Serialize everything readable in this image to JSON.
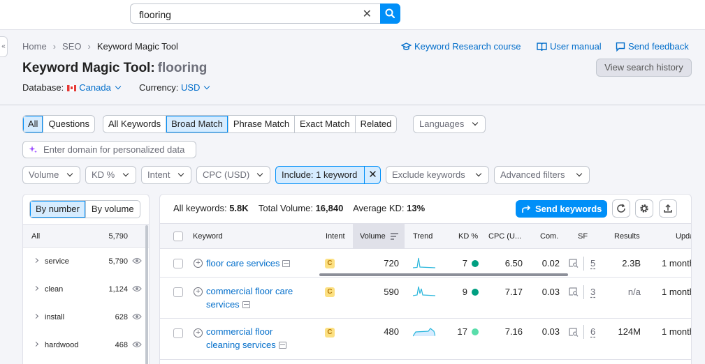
{
  "search": {
    "value": "flooring"
  },
  "breadcrumb": {
    "home": "Home",
    "seo": "SEO",
    "current": "Keyword Magic Tool"
  },
  "header_links": {
    "course": "Keyword Research course",
    "manual": "User manual",
    "feedback": "Send feedback"
  },
  "page": {
    "title": "Keyword Magic Tool:",
    "keyword": "flooring",
    "history_button": "View search history"
  },
  "database": {
    "label": "Database:",
    "value": "Canada",
    "currency_label": "Currency:",
    "currency_value": "USD"
  },
  "question_filter": [
    "All",
    "Questions"
  ],
  "match_filter": [
    "All Keywords",
    "Broad Match",
    "Phrase Match",
    "Exact Match",
    "Related"
  ],
  "languages_placeholder": "Languages",
  "personalize_placeholder": "Enter domain for personalized data",
  "filters": {
    "volume": "Volume",
    "kd": "KD %",
    "intent": "Intent",
    "cpc": "CPC (USD)",
    "include": "Include: 1 keyword",
    "exclude": "Exclude keywords",
    "advanced": "Advanced filters"
  },
  "left_panel": {
    "by_number": "By number",
    "by_volume": "By volume",
    "all_label": "All",
    "all_count": "5,790",
    "groups": [
      {
        "name": "service",
        "count": "5,790"
      },
      {
        "name": "clean",
        "count": "1,124"
      },
      {
        "name": "install",
        "count": "628"
      },
      {
        "name": "hardwood",
        "count": "468"
      }
    ]
  },
  "summary": {
    "all_kw_label": "All keywords:",
    "all_kw_value": "5.8K",
    "volume_label": "Total Volume:",
    "volume_value": "16,840",
    "kd_label": "Average KD:",
    "kd_value": "13%"
  },
  "send_keywords": "Send keywords",
  "table": {
    "headers": {
      "keyword": "Keyword",
      "intent": "Intent",
      "volume": "Volume",
      "trend": "Trend",
      "kd": "KD %",
      "cpc": "CPC (U...",
      "com": "Com.",
      "sf": "SF",
      "results": "Results",
      "updated": "Upda"
    },
    "rows": [
      {
        "line1": "floor care services",
        "line2": "",
        "intent": "C",
        "volume": "720",
        "kd": "7",
        "kd_color": "#009f81",
        "cpc": "6.50",
        "com": "0.02",
        "sf": "5",
        "results": "2.3B",
        "updated": "1 month"
      },
      {
        "line1": "commercial floor care",
        "line2": "services",
        "intent": "C",
        "volume": "590",
        "kd": "9",
        "kd_color": "#009f81",
        "cpc": "7.17",
        "com": "0.03",
        "sf": "3",
        "results": "n/a",
        "updated": "1 month"
      },
      {
        "line1": "commercial floor",
        "line2": "cleaning services",
        "intent": "C",
        "volume": "480",
        "kd": "17",
        "kd_color": "#59ddaa",
        "cpc": "7.16",
        "com": "0.03",
        "sf": "6",
        "results": "124M",
        "updated": "1 month"
      }
    ]
  },
  "colors": {
    "accent": "#008ff8",
    "link": "#006dca",
    "selected_bg": "#d6ecff",
    "intent_commercial": "#fce081"
  }
}
